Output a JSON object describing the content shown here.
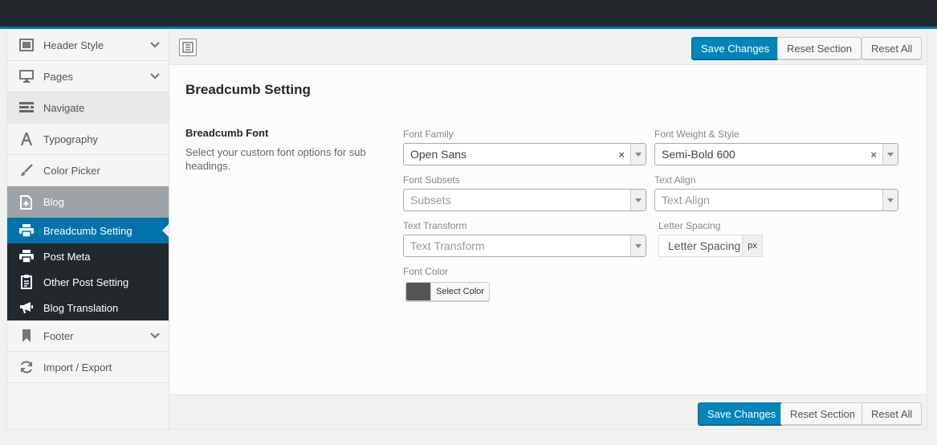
{
  "sidebar": {
    "items": [
      {
        "label": "Header Style",
        "icon": "layout-icon",
        "expandable": true
      },
      {
        "label": "Pages",
        "icon": "monitor-icon",
        "expandable": true
      },
      {
        "label": "Navigate",
        "icon": "menu-bars-icon",
        "expandable": false
      },
      {
        "label": "Typography",
        "icon": "letter-a-icon",
        "expandable": false
      },
      {
        "label": "Color Picker",
        "icon": "brush-icon",
        "expandable": false
      },
      {
        "label": "Blog",
        "icon": "add-document-icon",
        "expandable": false
      }
    ],
    "blog_submenu": [
      {
        "label": "Breadcumb Setting",
        "icon": "printer-icon",
        "current": true
      },
      {
        "label": "Post Meta",
        "icon": "printer-icon",
        "current": false
      },
      {
        "label": "Other Post Setting",
        "icon": "clipboard-icon",
        "current": false
      },
      {
        "label": "Blog Translation",
        "icon": "megaphone-icon",
        "current": false
      }
    ],
    "bottom_items": [
      {
        "label": "Footer",
        "icon": "bookmark-icon",
        "expandable": true
      },
      {
        "label": "Import / Export",
        "icon": "refresh-icon",
        "expandable": false
      }
    ]
  },
  "toolbar": {
    "save_label": "Save Changes",
    "reset_section_label": "Reset Section",
    "reset_all_label": "Reset All"
  },
  "section": {
    "title": "Breadcumb Setting",
    "field_title": "Breadcumb Font",
    "field_desc": "Select your custom font options for sub headings."
  },
  "font": {
    "family_label": "Font Family",
    "family_value": "Open Sans",
    "weight_label": "Font Weight & Style",
    "weight_value": "Semi-Bold 600",
    "subsets_label": "Font Subsets",
    "subsets_placeholder": "Subsets",
    "align_label": "Text Align",
    "align_placeholder": "Text Align",
    "transform_label": "Text Transform",
    "transform_placeholder": "Text Transform",
    "spacing_label": "Letter Spacing",
    "spacing_placeholder": "Letter Spacing",
    "spacing_unit": "px",
    "color_label": "Font Color",
    "color_button": "Select Color",
    "color_value": "#555555"
  },
  "colors": {
    "accent": "#0073aa",
    "primary_button": "#0085ba",
    "admin_bar": "#23282d",
    "blog_active": "#9ea3a8"
  }
}
